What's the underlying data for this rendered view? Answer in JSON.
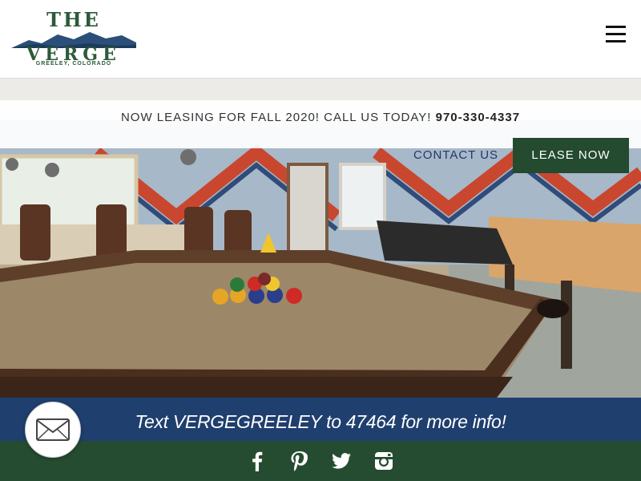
{
  "header": {
    "logo_top": "THE",
    "logo_main": "VERGE",
    "logo_location": "GREELEY, COLORADO"
  },
  "leasing": {
    "message": "NOW LEASING FOR FALL 2020! CALL US TODAY!",
    "phone": "970-330-4337"
  },
  "nav": {
    "contact_label": "CONTACT US",
    "lease_label": "LEASE NOW"
  },
  "banner": {
    "text": "Text VERGEGREELEY to 47464 for more info!"
  },
  "footer": {
    "social": [
      "facebook-icon",
      "pinterest-icon",
      "twitter-icon",
      "instagram-icon"
    ]
  },
  "colors": {
    "brand_green": "#244a30",
    "banner_blue": "#1f3f6e",
    "nav_blue": "#22386b"
  }
}
